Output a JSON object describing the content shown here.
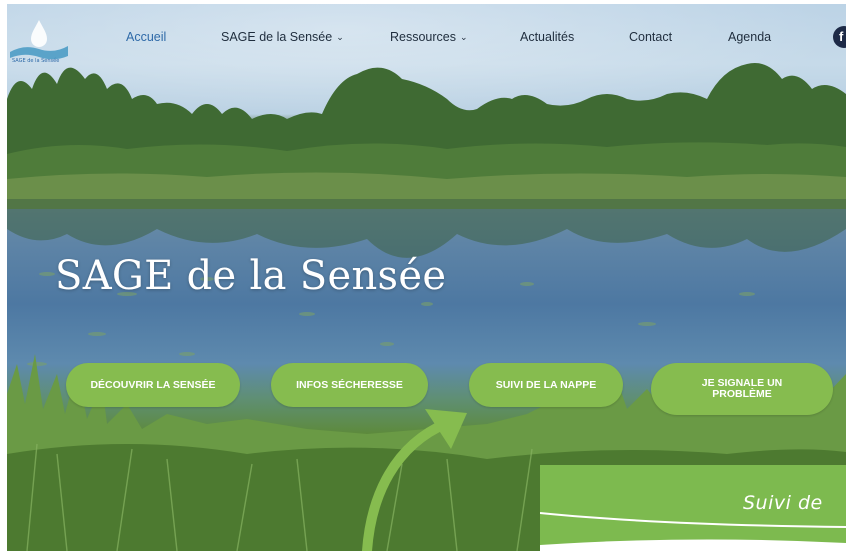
{
  "nav": {
    "logo_text": "SAGE de la Sensée",
    "items": [
      {
        "label": "Accueil"
      },
      {
        "label": "SAGE de la Sensée"
      },
      {
        "label": "Ressources"
      },
      {
        "label": "Actualités"
      },
      {
        "label": "Contact"
      },
      {
        "label": "Agenda"
      }
    ],
    "facebook": "f"
  },
  "hero": {
    "title": "SAGE de la Sensée",
    "buttons": [
      {
        "label": "DÉCOUVRIR LA SENSÉE"
      },
      {
        "label": "INFOS SÉCHERESSE"
      },
      {
        "label": "SUIVI DE LA NAPPE"
      },
      {
        "label_line1": "JE SIGNALE UN",
        "label_line2": "PROBLÈME"
      }
    ]
  },
  "card": {
    "title": "Suivi de"
  },
  "colors": {
    "accent_green": "#86bc4f",
    "nav_active": "#2f6aa8",
    "nav_text": "#1f2d3d"
  }
}
